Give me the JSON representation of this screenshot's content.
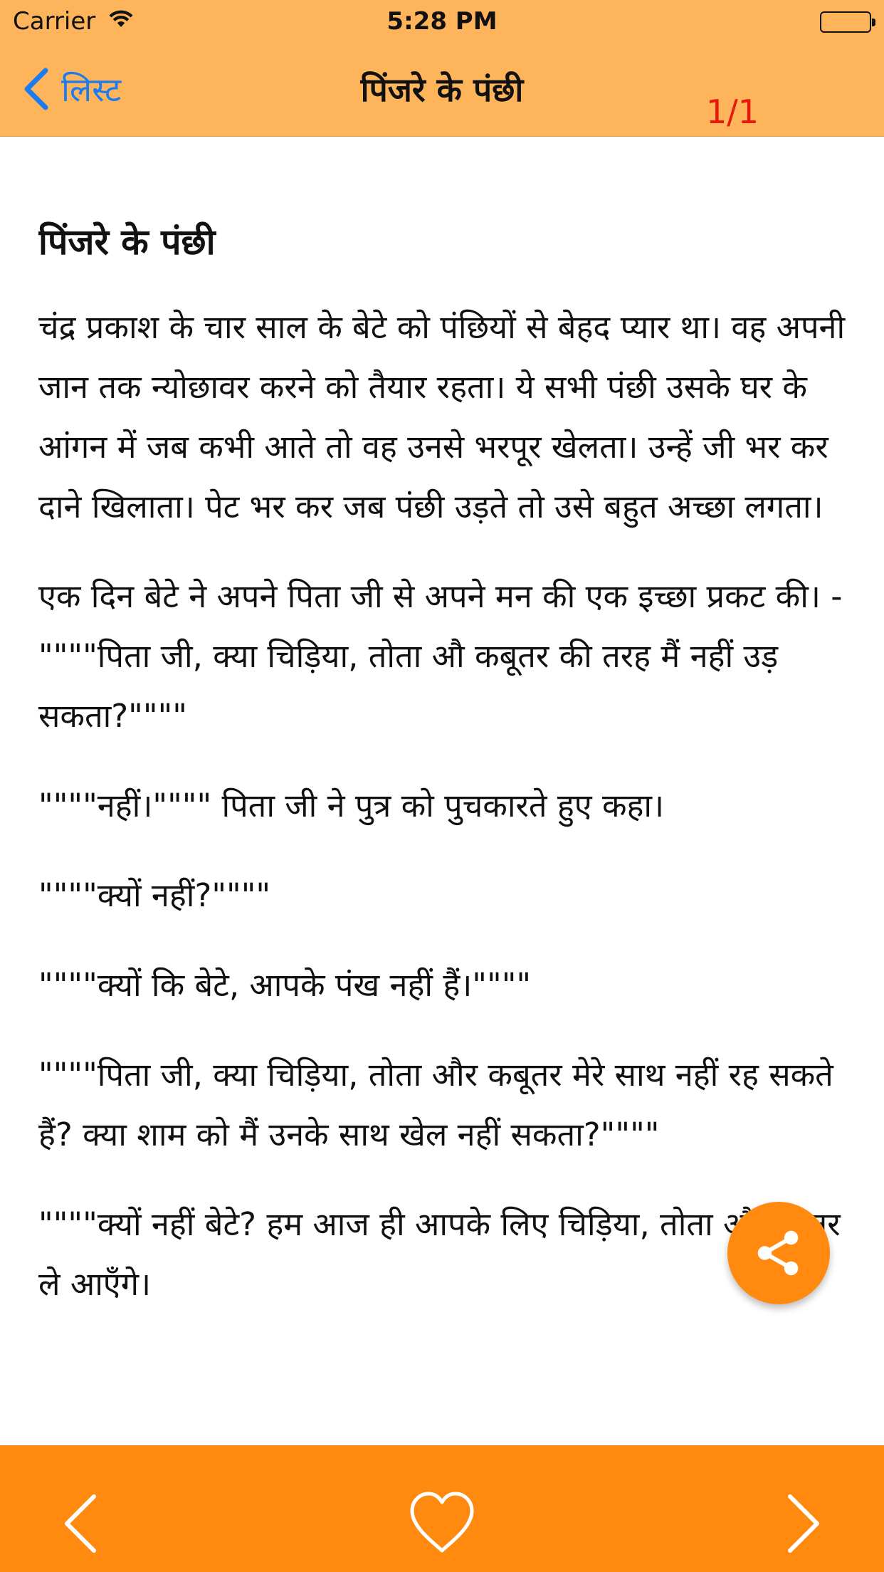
{
  "status_bar": {
    "carrier": "Carrier",
    "time": "5:28 PM"
  },
  "nav": {
    "back_label": "लिस्ट",
    "title": "पिंजरे के पंछी",
    "page_counter": "1/1"
  },
  "article": {
    "heading": "पिंजरे के पंछी",
    "paragraphs": [
      "चंद्र प्रकाश के चार साल के बेटे को पंछियों से बेहद प्यार था। वह अपनी जान तक न्योछावर करने को तैयार रहता। ये सभी पंछी उसके घर के आंगन में जब कभी आते तो वह उनसे भरपूर खेलता। उन्हें जी भर कर दाने खिलाता। पेट भर कर जब पंछी उड़ते तो उसे बहुत अच्छा लगता।",
      "एक दिन बेटे ने अपने पिता जी से अपने मन की एक इच्छा प्रकट की। - \"\"\"\"पिता जी, क्या चिड़िया, तोता औ कबूतर की तरह मैं नहीं उड़ सकता?\"\"\"\"",
      "\"\"\"\"नहीं।\"\"\"\" पिता जी ने पुत्र को पुचकारते हुए कहा।",
      "\"\"\"\"क्यों नहीं?\"\"\"\"",
      "\"\"\"\"क्यों कि बेटे, आपके पंख नहीं हैं।\"\"\"\"",
      "\"\"\"\"पिता जी, क्या चिड़िया, तोता और कबूतर मेरे साथ नहीं रह सकते हैं? क्या शाम को मैं उनके साथ खेल नहीं सकता?\"\"\"\"",
      "\"\"\"\"क्यों नहीं बेटे? हम आज ही आपके लिए चिड़िया, तोता औ कबूतर ले आएँगे।"
    ]
  },
  "colors": {
    "nav_bar": "#FDB45A",
    "toolbar": "#FF8A0F",
    "back_link": "#1a7cf0",
    "page_counter": "#e8180c"
  },
  "icons": {
    "back": "chevron-left-icon",
    "share": "share-icon",
    "previous": "chevron-left-icon",
    "favorite": "heart-outline-icon",
    "next": "chevron-right-icon"
  }
}
